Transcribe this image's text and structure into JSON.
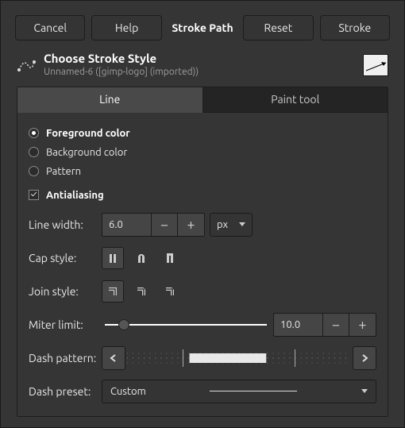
{
  "buttons": {
    "cancel": "Cancel",
    "help": "Help",
    "title": "Stroke Path",
    "reset": "Reset",
    "stroke": "Stroke"
  },
  "title": "Choose Stroke Style",
  "subtitle": "Unnamed-6 ([gimp-logo] (imported))",
  "tabs": {
    "line": "Line",
    "paint": "Paint tool"
  },
  "color": {
    "fg": "Foreground color",
    "bg": "Background color",
    "pat": "Pattern"
  },
  "antialias": "Antialiasing",
  "labels": {
    "lw": "Line width:",
    "cap": "Cap style:",
    "join": "Join style:",
    "miter": "Miter limit:",
    "dashpat": "Dash pattern:",
    "preset": "Dash preset:"
  },
  "values": {
    "lw": "6.0",
    "unit": "px",
    "miter": "10.0",
    "preset": "Custom"
  }
}
